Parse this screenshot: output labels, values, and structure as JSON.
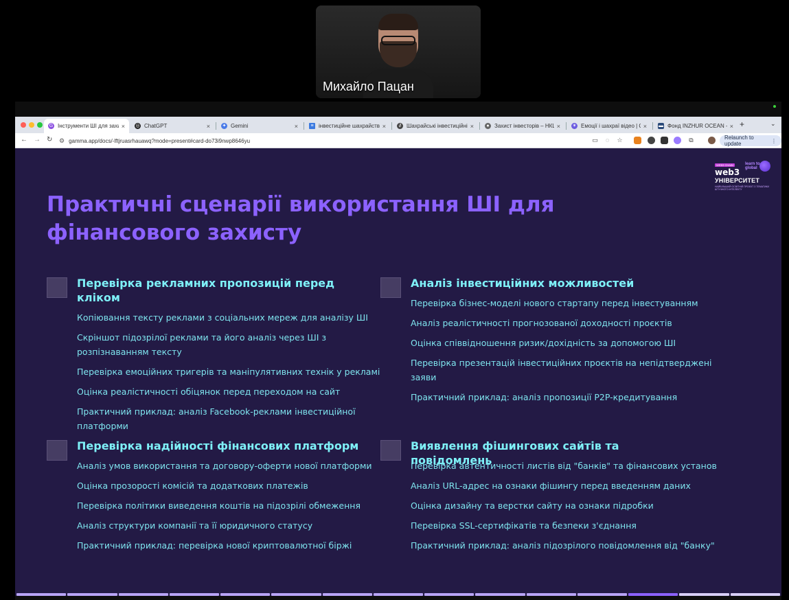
{
  "meeting": {
    "participant_name": "Михайло Пацан"
  },
  "browser": {
    "tabs": [
      {
        "label": "Інструменти ШІ для захисту",
        "icon": "gamma-icon",
        "active": true
      },
      {
        "label": "ChatGPT",
        "icon": "chatgpt-icon"
      },
      {
        "label": "Gemini",
        "icon": "gemini-icon"
      },
      {
        "label": "інвестиційне шахрайство і",
        "icon": "docs-icon"
      },
      {
        "label": "Шахрайські інвестиційні схе",
        "icon": "link-icon"
      },
      {
        "label": "Захист інвесторів – НКЦПФ",
        "icon": "globe-icon"
      },
      {
        "label": "Емоції і шахраї відео | Qwen",
        "icon": "qwen-icon"
      },
      {
        "label": "Фонд INZHUR OCEAN - інж",
        "icon": "site-icon"
      }
    ],
    "new_tab": "+",
    "tab_menu": "⌄",
    "url": "gamma.app/docs/-lftjruasrhauawq?mode=present#card-do73i9nwp8646yu",
    "relaunch_label": "Relaunch to update",
    "colors": {
      "tabstrip": "#dfe3eb",
      "toolbar": "#ffffff"
    }
  },
  "slide": {
    "logo": {
      "badge": "WEB3 CHAIN",
      "web3": "web3",
      "learn": "learn to earn global",
      "university": "УНІВЕРСИТЕТ",
      "subtitle": "НАЙБІЛЬШИЙ ОСВІТНІЙ ПРОЄКТ З ТЕМАТИКИ ШТУЧНОГО ІНТЕЛЕКТУ"
    },
    "title": "Практичні сценарії використання ШІ для фінансового захисту",
    "sections": [
      {
        "title": "Перевірка рекламних пропозицій перед кліком",
        "items": [
          "Копіювання тексту реклами з соціальних мереж для аналізу ШІ",
          "Скріншот підозрілої реклами та його аналіз через ШІ з розпізнаванням тексту",
          "Перевірка емоційних тригерів та маніпулятивних технік у рекламі",
          "Оцінка реалістичності обіцянок перед переходом на сайт",
          "Практичний приклад: аналіз Facebook-реклами інвестиційної платформи"
        ]
      },
      {
        "title": "Аналіз інвестиційних можливостей",
        "items": [
          "Перевірка бізнес-моделі нового стартапу перед інвестуванням",
          "Аналіз реалістичності прогнозованої доходності проєктів",
          "Оцінка співвідношення ризик/дохідність за допомогою ШІ",
          "Перевірка презентацій інвестиційних проєктів на непідтверджені заяви",
          "Практичний приклад: аналіз пропозиції P2P-кредитування"
        ]
      },
      {
        "title": "Перевірка надійності фінансових платформ",
        "items": [
          "Аналіз умов використання та договору-оферти нової платформи",
          "Оцінка прозорості комісій та додаткових платежів",
          "Перевірка політики виведення коштів на підозрілі обмеження",
          "Аналіз структури компанії та її юридичного статусу",
          "Практичний приклад: перевірка нової криптовалютної біржі"
        ]
      },
      {
        "title": "Виявлення фішингових сайтів та повідомлень",
        "items": [
          "Перевірка автентичності листів від \"банків\" та фінансових установ",
          "Аналіз URL-адрес на ознаки фішингу перед введенням даних",
          "Оцінка дизайну та верстки сайту на ознаки підробки",
          "Перевірка SSL-сертифікатів та безпеки з'єднання",
          "Практичний приклад: аналіз підозрілого повідомлення від \"банку\""
        ]
      }
    ],
    "progress": {
      "total_cards": 15,
      "current_card": 13
    },
    "colors": {
      "background": "#231a45",
      "title": "#8c62ff",
      "section_title": "#7ef0f7",
      "item": "#7ee4ee"
    }
  }
}
